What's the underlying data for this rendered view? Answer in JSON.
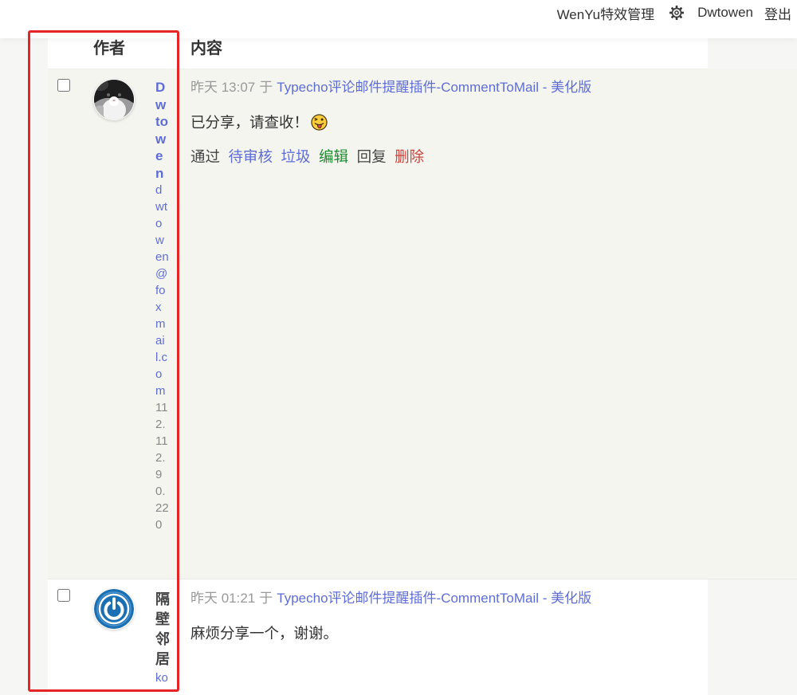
{
  "topbar": {
    "plugin_link": "WenYu特效管理",
    "settings_icon": "gear-icon",
    "user": "Dwtowen",
    "logout": "登出"
  },
  "table": {
    "headers": {
      "author": "作者",
      "content": "内容"
    },
    "rows": [
      {
        "avatar": "cat-photo",
        "author_name": "Dwtowen",
        "author_email": "dwtowen@foxmail.com",
        "author_ip": "112.112.90.220",
        "time": "昨天 13:07",
        "preposition": "于",
        "post_title": "Typecho评论邮件提醒插件-CommentToMail - 美化版",
        "text": "已分享，请查收！",
        "emoji": "winking-face-with-tongue",
        "actions": {
          "approve": "通过",
          "pending": "待审核",
          "spam": "垃圾",
          "edit": "编辑",
          "reply": "回复",
          "delete": "删除"
        }
      },
      {
        "avatar": "blue-power-symbol",
        "author_name": "隔壁邻居",
        "author_email": "ko",
        "time": "昨天 01:21",
        "preposition": "于",
        "post_title": "Typecho评论邮件提醒插件-CommentToMail - 美化版",
        "text": "麻烦分享一个，谢谢。"
      }
    ]
  },
  "colors": {
    "link": "#5e6dd6",
    "meta_text": "#999999",
    "body_text": "#333333",
    "ip_text": "#888888",
    "action_edit": "#1f8a2f",
    "action_delete": "#c8453d",
    "hover_row": "#f5f5f0",
    "annotation": "#e52525"
  }
}
